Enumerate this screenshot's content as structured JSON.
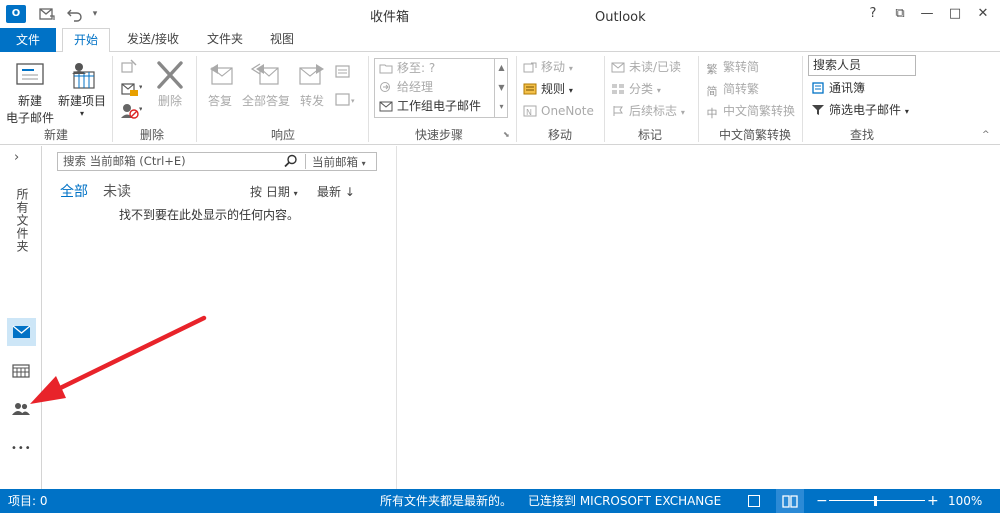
{
  "window": {
    "title": "收件箱",
    "app_name": "Outlook",
    "app_icon_text": "O",
    "help": "?",
    "controls": [
      "⧉",
      "—",
      "□",
      "✕"
    ]
  },
  "tabs": [
    {
      "label": "文件"
    },
    {
      "label": "开始"
    },
    {
      "label": "发送/接收"
    },
    {
      "label": "文件夹"
    },
    {
      "label": "视图"
    }
  ],
  "ribbon": {
    "new_group": {
      "new_email_line1": "新建",
      "new_email_line2": "电子邮件",
      "new_items": "新建项目",
      "label": "新建"
    },
    "delete_group": {
      "delete": "删除",
      "label": "删除"
    },
    "respond_group": {
      "reply": "答复",
      "reply_all": "全部答复",
      "forward": "转发",
      "label": "响应"
    },
    "quicksteps_group": {
      "items": [
        "移至: ?",
        "给经理",
        "工作组电子邮件"
      ],
      "label": "快速步骤"
    },
    "move_group": {
      "move": "移动",
      "rules": "规则",
      "onenote": "OneNote",
      "label": "移动"
    },
    "tags_group": {
      "unread_read": "未读/已读",
      "categorize": "分类",
      "follow_up": "后续标志",
      "label": "标记"
    },
    "chinese_group": {
      "to_traditional": "繁转简",
      "to_simplified": "简转繁",
      "convert": "中文简繁转换",
      "label": "中文简繁转换"
    },
    "find_group": {
      "search_people_placeholder": "搜索人员",
      "address_book": "通讯簿",
      "filter_email": "筛选电子邮件",
      "label": "查找"
    }
  },
  "nav": {
    "expand": "›",
    "all_folders": "所有文件夹",
    "more": "•••"
  },
  "mail_list": {
    "search_placeholder": "搜索 当前邮箱 (Ctrl+E)",
    "scope": "当前邮箱",
    "filter_all": "全部",
    "filter_unread": "未读",
    "sort_by": "按 日期",
    "order": "最新 ↓",
    "empty_message": "找不到要在此处显示的任何内容。"
  },
  "status_bar": {
    "items": "项目: 0",
    "folders_status": "所有文件夹都是最新的。",
    "connection": "已连接到 MICROSOFT EXCHANGE",
    "zoom": "100%"
  },
  "colors": {
    "accent": "#0072c6",
    "arrow": "#e8232a"
  }
}
